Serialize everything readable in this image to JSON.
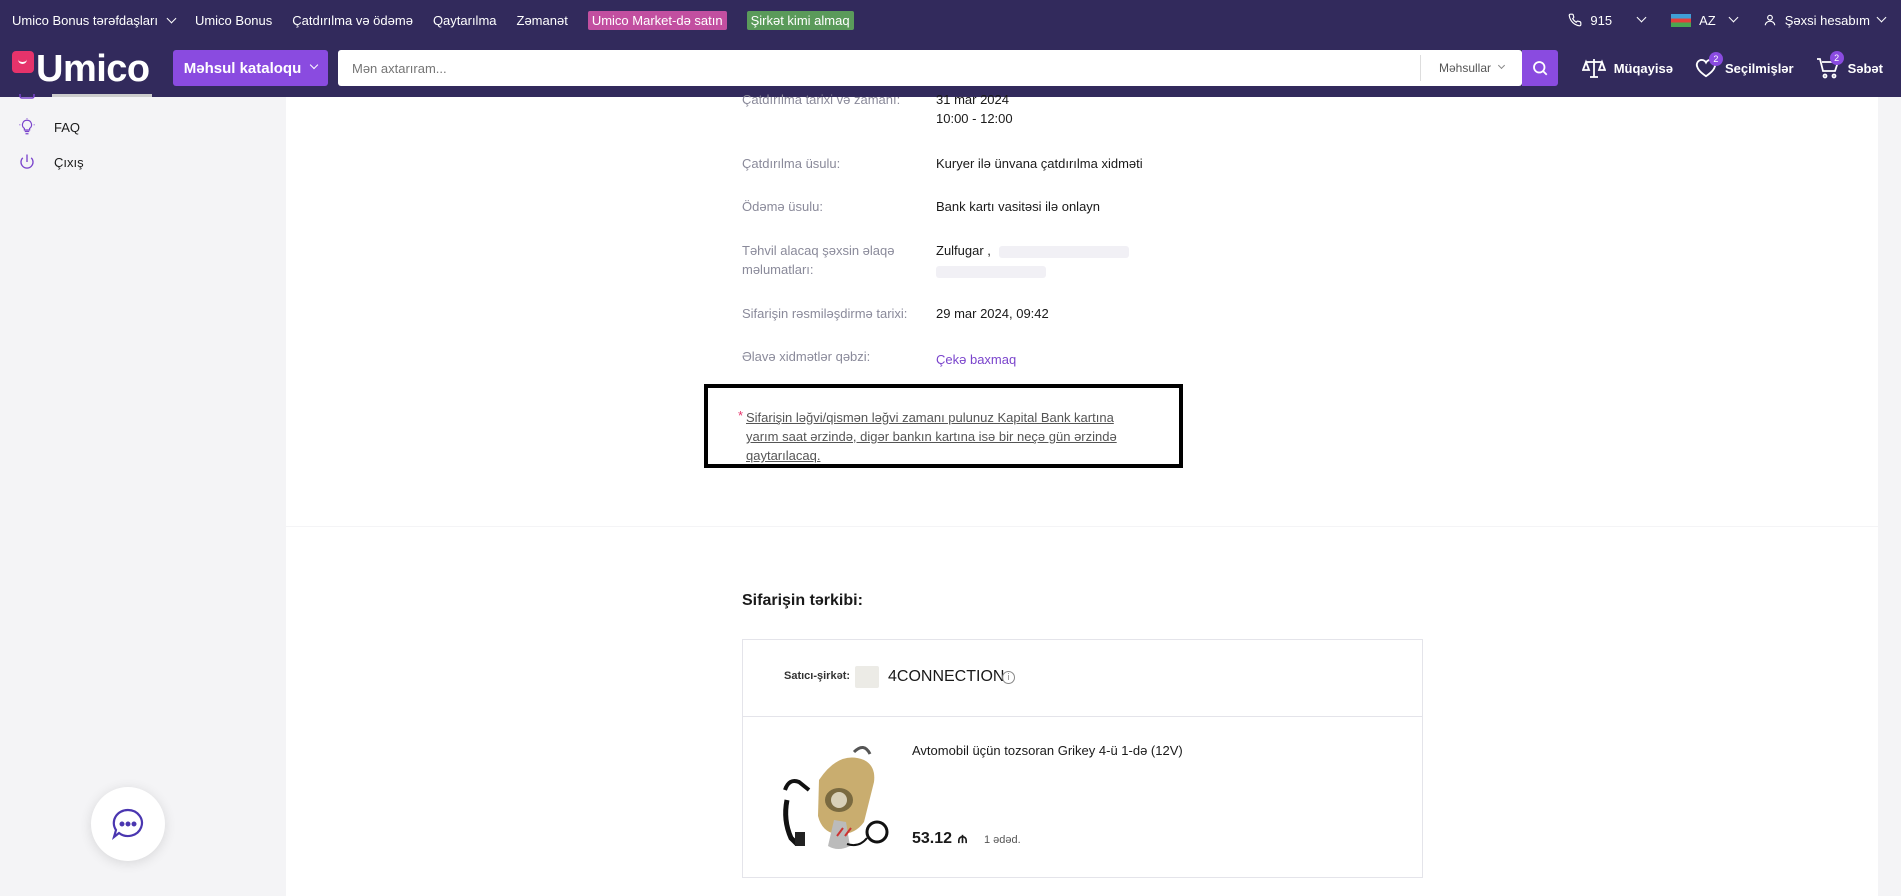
{
  "topbar": {
    "partners": "Umico Bonus tərəfdaşları",
    "links": [
      "Umico Bonus",
      "Çatdırılma və ödəmə",
      "Qaytarılma",
      "Zəmanət"
    ],
    "market_badge": "Umico Market-də satın",
    "company_badge": "Şirkət kimi almaq",
    "phone": "915",
    "language": "AZ",
    "account": "Şəxsi hesabım"
  },
  "header": {
    "logo": "Umico",
    "catalog": "Məhsul kataloqu",
    "search_placeholder": "Mən axtarıram...",
    "search_scope": "Məhsullar",
    "compare": "Müqayisə",
    "favorites": "Seçilmişlər",
    "favorites_count": "2",
    "cart": "Səbət",
    "cart_count": "2"
  },
  "sidebar": {
    "faq": "FAQ",
    "logout": "Çıxış"
  },
  "order": {
    "delivery_date_label": "Çatdırılma tarixi və zamanı:",
    "delivery_date": "31 mar 2024",
    "delivery_time": "10:00 - 12:00",
    "delivery_method_label": "Çatdırılma üsulu:",
    "delivery_method": "Kuryer ilə ünvana çatdırılma xidməti",
    "payment_label": "Ödəmə üsulu:",
    "payment": "Bank kartı vasitəsi ilə onlayn",
    "contact_label": "Təhvil alacaq şəxsin əlaqə məlumatları:",
    "contact_name": "Zulfugar ,",
    "created_label": "Sifarişin rəsmiləşdirmə tarixi:",
    "created": "29 mar 2024, 09:42",
    "receipt_label": "Əlavə xidmətlər qəbzi:",
    "receipt_link": "Çekə baxmaq",
    "notice": "Sifarişin ləğvi/qismən ləğvi zamanı pulunuz Kapital Bank kartına yarım saat ərzində, digər bankın kartına isə bir neçə gün ərzində qaytarılacaq."
  },
  "composition": {
    "title": "Sifarişin tərkibi:",
    "seller_label": "Satıcı-şirkət:",
    "seller_name": "4CONNECTION",
    "product_name": "Avtomobil üçün tozsoran Grikey 4-ü 1-də (12V)",
    "price": "53.12",
    "qty": "1 ədəd."
  },
  "colors": {
    "brand_dark": "#322a5c",
    "accent_purple": "#8a4be0",
    "market_badge": "#c24fa0",
    "company_badge": "#5a9a5a",
    "logo_pink": "#e6336b"
  }
}
